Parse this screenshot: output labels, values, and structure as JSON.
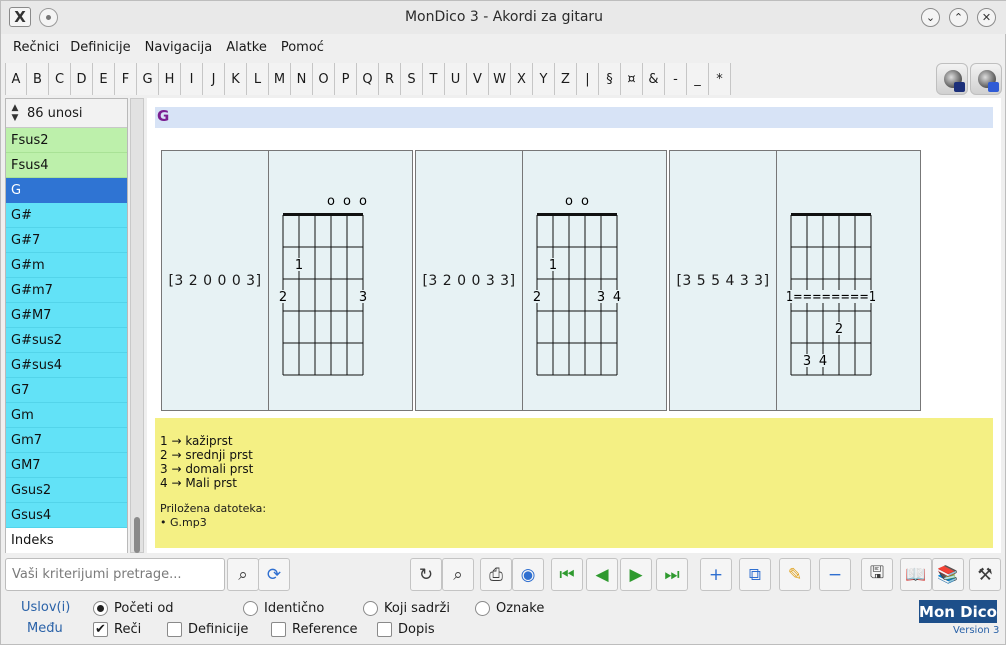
{
  "window": {
    "title": "MonDico 3 - Akordi za gitaru",
    "app_icon_label": "X",
    "buttons": {
      "minimize": "⌄",
      "maximize": "⌃",
      "close": "✕"
    }
  },
  "menu": [
    "Rečnici",
    "Definicije",
    "Navigacija",
    "Alatke",
    "Pomoć"
  ],
  "alphabet": [
    "A",
    "B",
    "C",
    "D",
    "E",
    "F",
    "G",
    "H",
    "I",
    "J",
    "K",
    "L",
    "M",
    "N",
    "O",
    "P",
    "Q",
    "R",
    "S",
    "T",
    "U",
    "V",
    "W",
    "X",
    "Y",
    "Z",
    "|",
    "§",
    "¤",
    "&",
    "-",
    "_",
    "*"
  ],
  "sidebar": {
    "count_label": "86 unosi",
    "entries": [
      {
        "label": "Fsus2",
        "style": "green"
      },
      {
        "label": "Fsus4",
        "style": "green"
      },
      {
        "label": "G",
        "style": "selected"
      },
      {
        "label": "G#",
        "style": "cyan"
      },
      {
        "label": "G#7",
        "style": "cyan"
      },
      {
        "label": "G#m",
        "style": "cyan"
      },
      {
        "label": "G#m7",
        "style": "cyan"
      },
      {
        "label": "G#M7",
        "style": "cyan"
      },
      {
        "label": "G#sus2",
        "style": "cyan"
      },
      {
        "label": "G#sus4",
        "style": "cyan"
      },
      {
        "label": "G7",
        "style": "cyan"
      },
      {
        "label": "Gm",
        "style": "cyan"
      },
      {
        "label": "Gm7",
        "style": "cyan"
      },
      {
        "label": "GM7",
        "style": "cyan"
      },
      {
        "label": "Gsus2",
        "style": "cyan"
      },
      {
        "label": "Gsus4",
        "style": "cyan"
      },
      {
        "label": "Indeks",
        "style": "white"
      }
    ]
  },
  "entry": {
    "word": "G",
    "chords": [
      {
        "code": "[3 2 0 0 0 3]",
        "open_label": "o o o",
        "open_strings": [
          3,
          4,
          5
        ],
        "dots": [
          {
            "string": 1,
            "fret": 2,
            "label": "1"
          },
          {
            "string": 0,
            "fret": 3,
            "label": "2"
          },
          {
            "string": 5,
            "fret": 3,
            "label": "3"
          }
        ],
        "barre": null
      },
      {
        "code": "[3 2 0 0 3 3]",
        "open_label": "o o",
        "open_strings": [
          2,
          3
        ],
        "dots": [
          {
            "string": 1,
            "fret": 2,
            "label": "1"
          },
          {
            "string": 0,
            "fret": 3,
            "label": "2"
          },
          {
            "string": 4,
            "fret": 3,
            "label": "3"
          },
          {
            "string": 5,
            "fret": 3,
            "label": "4"
          }
        ],
        "barre": null
      },
      {
        "code": "[3 5 5 4 3 3]",
        "open_label": "",
        "open_strings": [],
        "dots": [
          {
            "string": 3,
            "fret": 4,
            "label": "2"
          },
          {
            "string": 1,
            "fret": 5,
            "label": "3"
          },
          {
            "string": 2,
            "fret": 5,
            "label": "4"
          }
        ],
        "barre": {
          "fret": 3,
          "label": "1========1"
        }
      }
    ],
    "legend": [
      "1 → kažiprst",
      "2 → srednji prst",
      "3 → domali prst",
      "4 → Mali prst"
    ],
    "attachment_title": "Priložena datoteka:",
    "attachment_file": "• G.mp3"
  },
  "search": {
    "placeholder": "Vaši kriterijumi pretrage..."
  },
  "options": {
    "label_top": "Uslov(i)",
    "label_bottom": "Među",
    "radios": [
      {
        "label": "Početi od",
        "checked": true
      },
      {
        "label": "Identično",
        "checked": false
      },
      {
        "label": "Koji sadrži",
        "checked": false
      },
      {
        "label": "Oznake",
        "checked": false
      }
    ],
    "checks": [
      {
        "label": "Reči",
        "checked": true
      },
      {
        "label": "Definicije",
        "checked": false
      },
      {
        "label": "Reference",
        "checked": false
      },
      {
        "label": "Dopis",
        "checked": false
      }
    ]
  },
  "brand": {
    "logo": "Mon Dico",
    "version": "Version 3"
  },
  "icons": {
    "refresh": "refresh-icon",
    "search": "magnifier-icon",
    "print": "printer-icon",
    "web": "globe-icon",
    "first": "first-icon",
    "prev": "prev-icon",
    "next": "next-icon",
    "last": "last-icon",
    "add": "plus-icon",
    "copy": "copy-icon",
    "edit": "pencil-icon",
    "remove": "minus-icon",
    "save": "floppy-icon",
    "book": "book-icon",
    "books": "books-icon",
    "tools": "tools-icon"
  }
}
